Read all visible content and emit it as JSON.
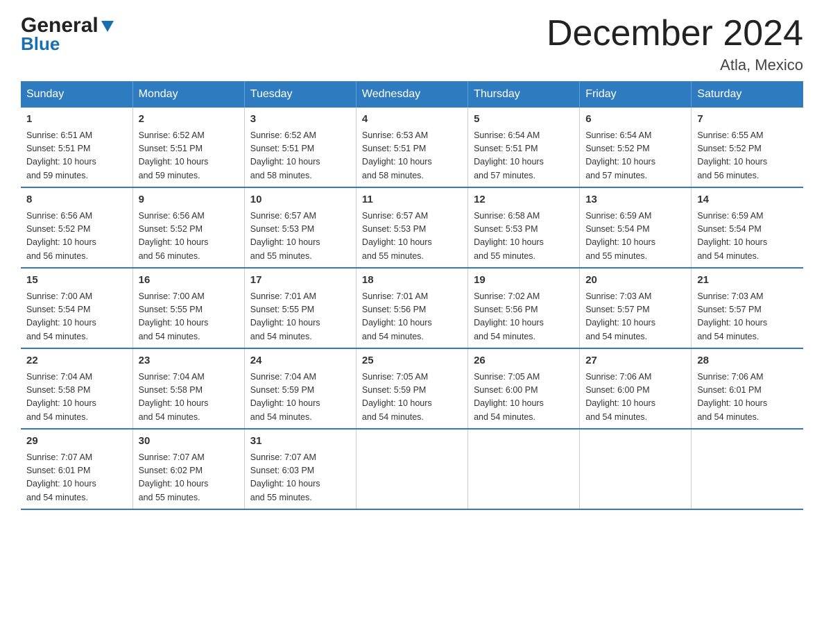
{
  "logo": {
    "general": "General",
    "blue": "Blue",
    "triangle_char": "▶"
  },
  "title": "December 2024",
  "location": "Atla, Mexico",
  "headers": [
    "Sunday",
    "Monday",
    "Tuesday",
    "Wednesday",
    "Thursday",
    "Friday",
    "Saturday"
  ],
  "weeks": [
    [
      {
        "day": "1",
        "sunrise": "Sunrise: 6:51 AM",
        "sunset": "Sunset: 5:51 PM",
        "daylight": "Daylight: 10 hours",
        "daylight2": "and 59 minutes."
      },
      {
        "day": "2",
        "sunrise": "Sunrise: 6:52 AM",
        "sunset": "Sunset: 5:51 PM",
        "daylight": "Daylight: 10 hours",
        "daylight2": "and 59 minutes."
      },
      {
        "day": "3",
        "sunrise": "Sunrise: 6:52 AM",
        "sunset": "Sunset: 5:51 PM",
        "daylight": "Daylight: 10 hours",
        "daylight2": "and 58 minutes."
      },
      {
        "day": "4",
        "sunrise": "Sunrise: 6:53 AM",
        "sunset": "Sunset: 5:51 PM",
        "daylight": "Daylight: 10 hours",
        "daylight2": "and 58 minutes."
      },
      {
        "day": "5",
        "sunrise": "Sunrise: 6:54 AM",
        "sunset": "Sunset: 5:51 PM",
        "daylight": "Daylight: 10 hours",
        "daylight2": "and 57 minutes."
      },
      {
        "day": "6",
        "sunrise": "Sunrise: 6:54 AM",
        "sunset": "Sunset: 5:52 PM",
        "daylight": "Daylight: 10 hours",
        "daylight2": "and 57 minutes."
      },
      {
        "day": "7",
        "sunrise": "Sunrise: 6:55 AM",
        "sunset": "Sunset: 5:52 PM",
        "daylight": "Daylight: 10 hours",
        "daylight2": "and 56 minutes."
      }
    ],
    [
      {
        "day": "8",
        "sunrise": "Sunrise: 6:56 AM",
        "sunset": "Sunset: 5:52 PM",
        "daylight": "Daylight: 10 hours",
        "daylight2": "and 56 minutes."
      },
      {
        "day": "9",
        "sunrise": "Sunrise: 6:56 AM",
        "sunset": "Sunset: 5:52 PM",
        "daylight": "Daylight: 10 hours",
        "daylight2": "and 56 minutes."
      },
      {
        "day": "10",
        "sunrise": "Sunrise: 6:57 AM",
        "sunset": "Sunset: 5:53 PM",
        "daylight": "Daylight: 10 hours",
        "daylight2": "and 55 minutes."
      },
      {
        "day": "11",
        "sunrise": "Sunrise: 6:57 AM",
        "sunset": "Sunset: 5:53 PM",
        "daylight": "Daylight: 10 hours",
        "daylight2": "and 55 minutes."
      },
      {
        "day": "12",
        "sunrise": "Sunrise: 6:58 AM",
        "sunset": "Sunset: 5:53 PM",
        "daylight": "Daylight: 10 hours",
        "daylight2": "and 55 minutes."
      },
      {
        "day": "13",
        "sunrise": "Sunrise: 6:59 AM",
        "sunset": "Sunset: 5:54 PM",
        "daylight": "Daylight: 10 hours",
        "daylight2": "and 55 minutes."
      },
      {
        "day": "14",
        "sunrise": "Sunrise: 6:59 AM",
        "sunset": "Sunset: 5:54 PM",
        "daylight": "Daylight: 10 hours",
        "daylight2": "and 54 minutes."
      }
    ],
    [
      {
        "day": "15",
        "sunrise": "Sunrise: 7:00 AM",
        "sunset": "Sunset: 5:54 PM",
        "daylight": "Daylight: 10 hours",
        "daylight2": "and 54 minutes."
      },
      {
        "day": "16",
        "sunrise": "Sunrise: 7:00 AM",
        "sunset": "Sunset: 5:55 PM",
        "daylight": "Daylight: 10 hours",
        "daylight2": "and 54 minutes."
      },
      {
        "day": "17",
        "sunrise": "Sunrise: 7:01 AM",
        "sunset": "Sunset: 5:55 PM",
        "daylight": "Daylight: 10 hours",
        "daylight2": "and 54 minutes."
      },
      {
        "day": "18",
        "sunrise": "Sunrise: 7:01 AM",
        "sunset": "Sunset: 5:56 PM",
        "daylight": "Daylight: 10 hours",
        "daylight2": "and 54 minutes."
      },
      {
        "day": "19",
        "sunrise": "Sunrise: 7:02 AM",
        "sunset": "Sunset: 5:56 PM",
        "daylight": "Daylight: 10 hours",
        "daylight2": "and 54 minutes."
      },
      {
        "day": "20",
        "sunrise": "Sunrise: 7:03 AM",
        "sunset": "Sunset: 5:57 PM",
        "daylight": "Daylight: 10 hours",
        "daylight2": "and 54 minutes."
      },
      {
        "day": "21",
        "sunrise": "Sunrise: 7:03 AM",
        "sunset": "Sunset: 5:57 PM",
        "daylight": "Daylight: 10 hours",
        "daylight2": "and 54 minutes."
      }
    ],
    [
      {
        "day": "22",
        "sunrise": "Sunrise: 7:04 AM",
        "sunset": "Sunset: 5:58 PM",
        "daylight": "Daylight: 10 hours",
        "daylight2": "and 54 minutes."
      },
      {
        "day": "23",
        "sunrise": "Sunrise: 7:04 AM",
        "sunset": "Sunset: 5:58 PM",
        "daylight": "Daylight: 10 hours",
        "daylight2": "and 54 minutes."
      },
      {
        "day": "24",
        "sunrise": "Sunrise: 7:04 AM",
        "sunset": "Sunset: 5:59 PM",
        "daylight": "Daylight: 10 hours",
        "daylight2": "and 54 minutes."
      },
      {
        "day": "25",
        "sunrise": "Sunrise: 7:05 AM",
        "sunset": "Sunset: 5:59 PM",
        "daylight": "Daylight: 10 hours",
        "daylight2": "and 54 minutes."
      },
      {
        "day": "26",
        "sunrise": "Sunrise: 7:05 AM",
        "sunset": "Sunset: 6:00 PM",
        "daylight": "Daylight: 10 hours",
        "daylight2": "and 54 minutes."
      },
      {
        "day": "27",
        "sunrise": "Sunrise: 7:06 AM",
        "sunset": "Sunset: 6:00 PM",
        "daylight": "Daylight: 10 hours",
        "daylight2": "and 54 minutes."
      },
      {
        "day": "28",
        "sunrise": "Sunrise: 7:06 AM",
        "sunset": "Sunset: 6:01 PM",
        "daylight": "Daylight: 10 hours",
        "daylight2": "and 54 minutes."
      }
    ],
    [
      {
        "day": "29",
        "sunrise": "Sunrise: 7:07 AM",
        "sunset": "Sunset: 6:01 PM",
        "daylight": "Daylight: 10 hours",
        "daylight2": "and 54 minutes."
      },
      {
        "day": "30",
        "sunrise": "Sunrise: 7:07 AM",
        "sunset": "Sunset: 6:02 PM",
        "daylight": "Daylight: 10 hours",
        "daylight2": "and 55 minutes."
      },
      {
        "day": "31",
        "sunrise": "Sunrise: 7:07 AM",
        "sunset": "Sunset: 6:03 PM",
        "daylight": "Daylight: 10 hours",
        "daylight2": "and 55 minutes."
      },
      null,
      null,
      null,
      null
    ]
  ],
  "colors": {
    "header_bg": "#2e7bbf",
    "header_text": "#ffffff",
    "border": "#2e7bbf",
    "logo_blue": "#1a6faf"
  }
}
